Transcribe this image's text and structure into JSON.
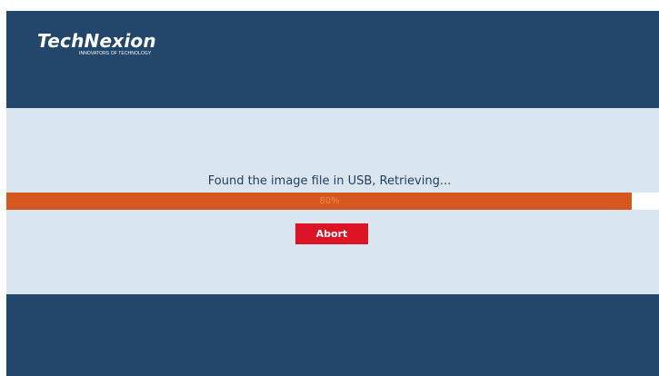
{
  "header": {
    "logo_name": "TechNexion",
    "logo_tagline": "INNOVATORS OF TECHNOLOGY"
  },
  "main": {
    "status_text": "Found the image file in USB, Retrieving...",
    "progress": {
      "percent": 80,
      "label": "80%"
    },
    "abort_label": "Abort"
  },
  "colors": {
    "header_bg": "#23466b",
    "content_bg": "#dae6ef",
    "progress_fill": "#d5581f",
    "abort_button": "#dd1426"
  }
}
